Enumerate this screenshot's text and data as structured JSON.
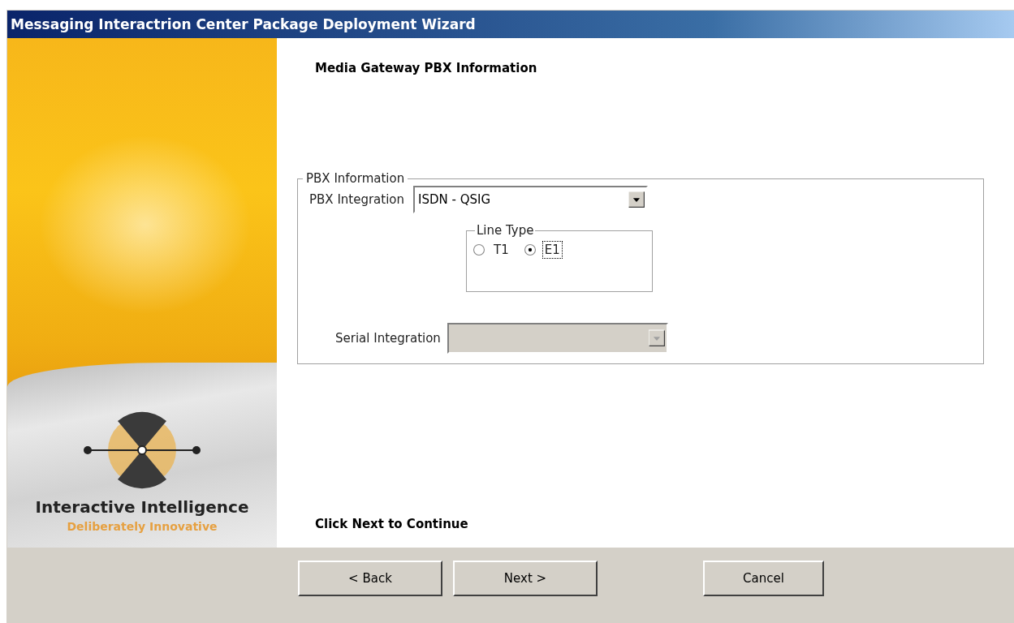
{
  "window": {
    "title": "Messaging Interactrion Center Package Deployment Wizard"
  },
  "side_panel": {
    "brand": "Interactive Intelligence",
    "tagline": "Deliberately Innovative"
  },
  "heading": "Media Gateway PBX Information",
  "group": {
    "title": "PBX Information",
    "pbx_integration": {
      "label": "PBX Integration",
      "value": "ISDN - QSIG",
      "disabled": false
    },
    "line_type": {
      "title": "Line Type",
      "options": [
        {
          "label": "T1",
          "selected": false,
          "focused": false
        },
        {
          "label": "E1",
          "selected": true,
          "focused": true
        }
      ]
    },
    "serial_integration": {
      "label": "Serial Integration",
      "disabled": true
    }
  },
  "footer_note": "Click Next to Continue",
  "buttons": [
    {
      "label": "< Back",
      "kind": "back"
    },
    {
      "label": "Next >",
      "kind": "next"
    },
    {
      "label": "Cancel",
      "kind": "cancel"
    }
  ]
}
